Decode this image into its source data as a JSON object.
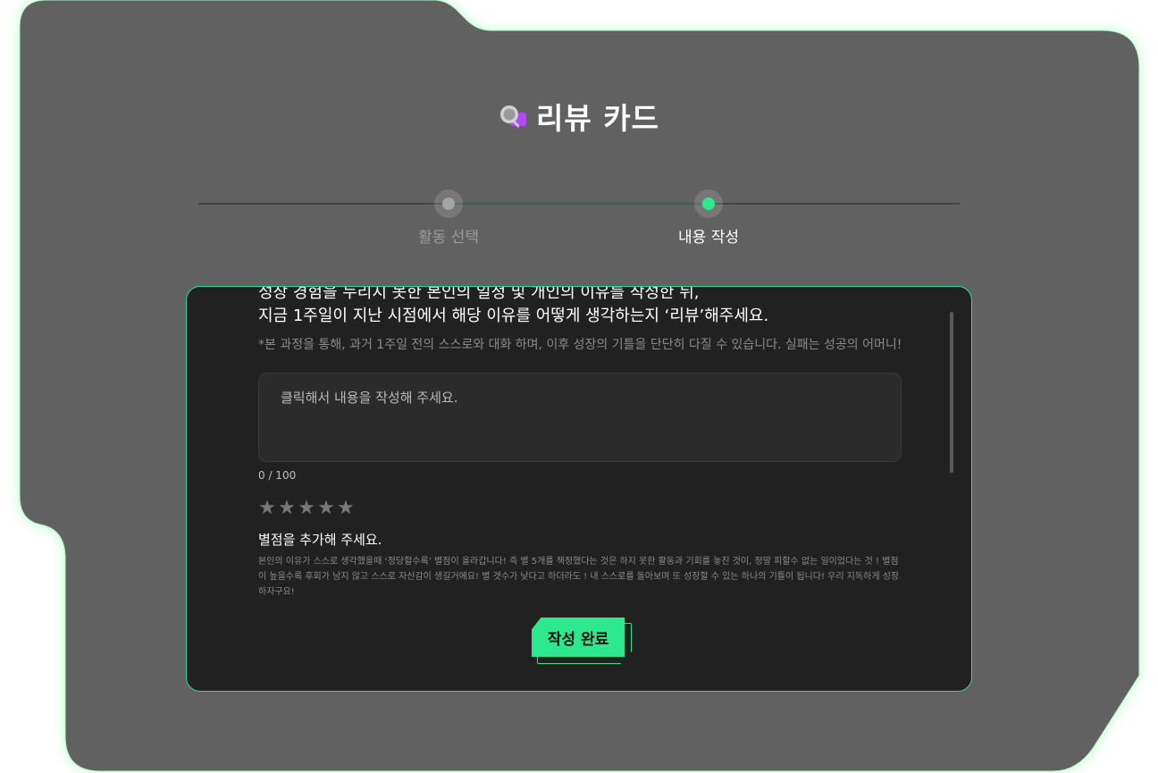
{
  "header": {
    "title": "리뷰 카드",
    "icon": "speech-bubble-search-icon"
  },
  "stepper": {
    "steps": [
      {
        "label": "활동 선택",
        "state": "done"
      },
      {
        "label": "내용 작성",
        "state": "active"
      }
    ]
  },
  "form": {
    "question_line1": "성장 경험을 누리지 못한 본인의 일정 및 개인의 이유를 작성한 뒤,",
    "question_line2": "지금 1주일이 지난 시점에서 해당 이유를 어떻게 생각하는지 ‘리뷰’해주세요.",
    "hint": "*본 과정을 통해, 과거 1주일 전의 스스로와 대화 하며, 이후 성장의 기틀을 단단히 다질 수 있습니다. 실패는 성공의 어머니!",
    "textarea_placeholder": "클릭해서 내용을 작성해 주세요.",
    "counter": "0 / 100",
    "rating": {
      "value": 0,
      "max": 5,
      "title": "별점을 추가해 주세요.",
      "description": "본인의 이유가 스스로 생각했을때 ‘정당할수록’ 별점이 올라갑니다! 즉 별 5개를 책정했다는 것은 하지 못한 활동과 기회를 놓친 것이, 정말 피할수 없는 일이었다는 것 ! 별점이 높을수록 후회가 남지 않고 스스로 자신감이 생길거에요! 별 갯수가 낮다고 하더라도 ! 내 스스로를 돌아보며 또 성장할 수 있는 하나의 기틀이 됩니다! 우리 지독하게 성장하자구요!"
    },
    "submit_label": "작성 완료"
  },
  "colors": {
    "accent": "#2ee88f",
    "panel": "#616161",
    "card": "#212121"
  }
}
